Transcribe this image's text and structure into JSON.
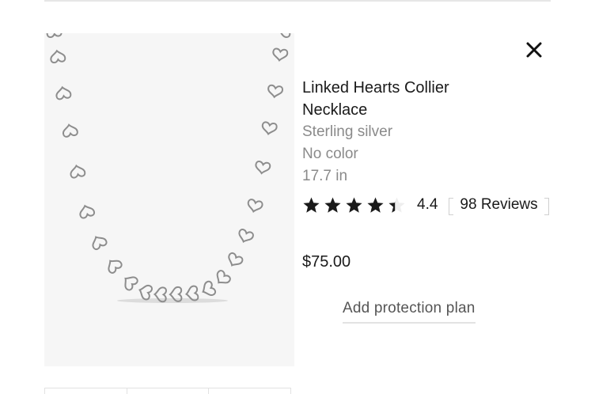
{
  "product": {
    "title": "Linked Hearts Collier Necklace",
    "material": "Sterling silver",
    "color": "No color",
    "size": "17.7 in",
    "image_icon": "necklace-product-image"
  },
  "rating": {
    "value": "4.4",
    "max": 5,
    "filled": 4.4,
    "reviews_label": "98 Reviews",
    "star_color": "#1a1a1a"
  },
  "price": {
    "amount": "$75.00"
  },
  "protection": {
    "label": "Add protection plan"
  },
  "close": {
    "icon": "close-icon"
  }
}
